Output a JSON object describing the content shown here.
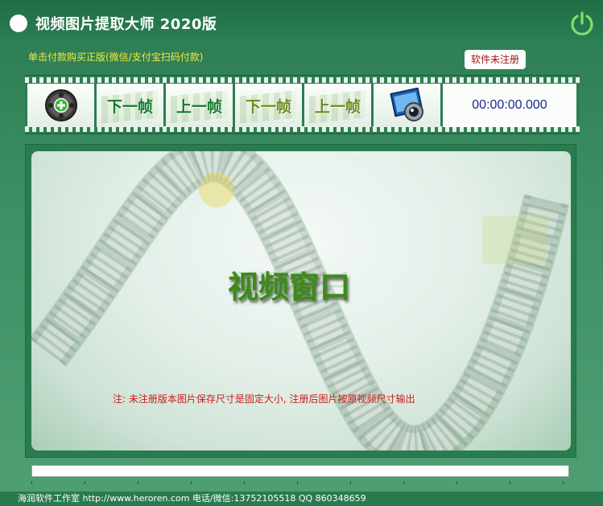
{
  "window": {
    "title": "视频图片提取大师  2020版"
  },
  "header": {
    "buy_link": "单击付款购买正版(微信/支付宝扫码付款)",
    "register_status": "软件未注册"
  },
  "toolbar": {
    "buttons": [
      {
        "icon": "open-video-icon"
      },
      {
        "label": "下一帧"
      },
      {
        "label": "上一帧"
      },
      {
        "label": "下一帧"
      },
      {
        "label": "上一帧"
      },
      {
        "icon": "snapshot-photo-icon"
      }
    ],
    "timecode": "00:00:00.000"
  },
  "video": {
    "placeholder": "视频窗口",
    "note": "注: 未注册版本图片保存尺寸是固定大小,  注册后图片按原视频尺寸输出"
  },
  "playback": {
    "progress": 0
  },
  "statusbar": {
    "text": "海润软件工作室 http://www.heroren.com  电话/微信:13752105518  QQ 860348659"
  },
  "colors": {
    "accent": "#2a7c4f",
    "buy_link": "#f4ea3a",
    "note": "#cc1a1a",
    "timecode": "#1a2a8a"
  }
}
